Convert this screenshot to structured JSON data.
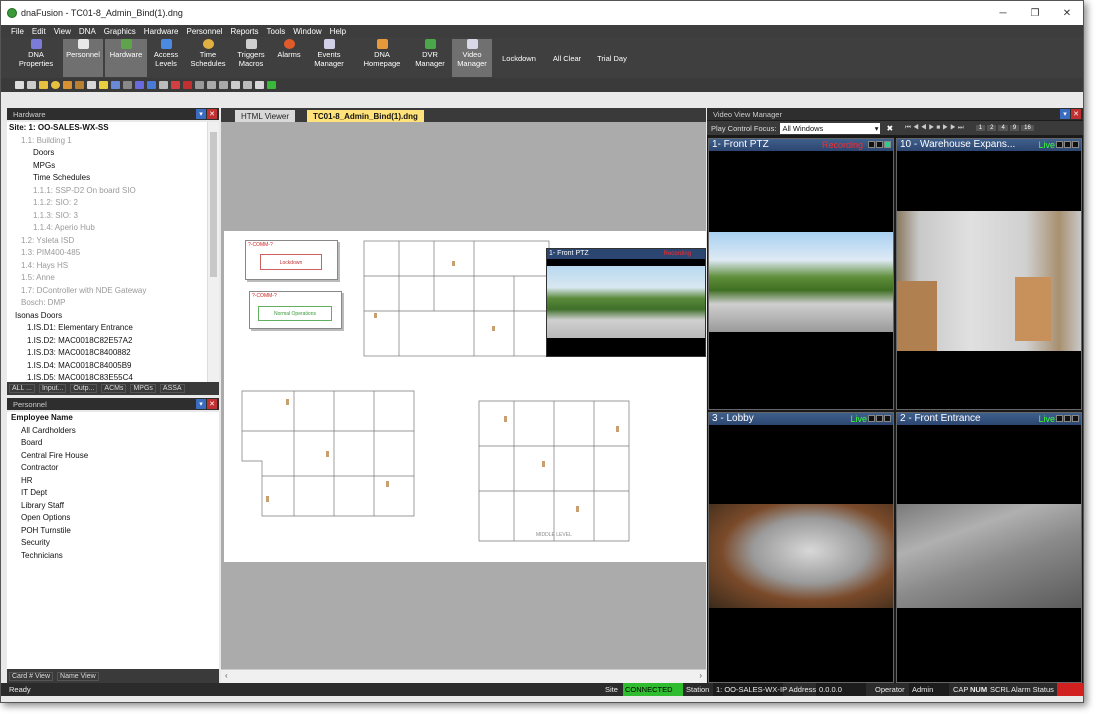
{
  "window": {
    "title": "dnaFusion - TC01-8_Admin_Bind(1).dng",
    "minimize": "─",
    "restore": "❐",
    "close": "✕"
  },
  "menu": [
    "File",
    "Edit",
    "View",
    "DNA",
    "Graphics",
    "Hardware",
    "Personnel",
    "Reports",
    "Tools",
    "Window",
    "Help"
  ],
  "ribbon": [
    {
      "l1": "DNA",
      "l2": "Properties"
    },
    {
      "l1": "Personnel",
      "l2": ""
    },
    {
      "l1": "Hardware",
      "l2": ""
    },
    {
      "l1": "Access",
      "l2": "Levels"
    },
    {
      "l1": "Time",
      "l2": "Schedules"
    },
    {
      "l1": "Triggers",
      "l2": "Macros"
    },
    {
      "l1": "Alarms",
      "l2": ""
    },
    {
      "l1": "Events",
      "l2": "Manager"
    },
    {
      "l1": "DNA",
      "l2": "Homepage"
    },
    {
      "l1": "DVR",
      "l2": "Manager"
    },
    {
      "l1": "Video",
      "l2": "Manager"
    },
    {
      "l1": "Lockdown",
      "l2": ""
    },
    {
      "l1": "All Clear",
      "l2": ""
    },
    {
      "l1": "Trial Day",
      "l2": ""
    }
  ],
  "hardware_panel": {
    "title": "Hardware",
    "items": [
      "Site: 1: OO-SALES-WX-SS",
      "1.1: Building 1",
      "Doors",
      "MPGs",
      "Time Schedules",
      "1.1.1: SSP-D2 On board SIO",
      "1.1.2: SIO: 2",
      "1.1.3: SIO: 3",
      "1.1.4: Aperio Hub",
      "1.2: Ysleta ISD",
      "1.3: PIM400-485",
      "1.4: Hays HS",
      "1.5: Anne",
      "1.7: DController with NDE Gateway",
      "Bosch: DMP",
      "Isonas Doors",
      "1.IS.D1: Elementary Entrance",
      "1.IS.D2: MAC0018C82E57A2",
      "1.IS.D3: MAC0018C8400882",
      "1.IS.D4: MAC0018C84005B9",
      "1.IS.D5: MAC0018C83E55C4"
    ],
    "tabs": [
      "ALL ...",
      "Input...",
      "Outp...",
      "ACMs",
      "MPGs",
      "ASSA"
    ]
  },
  "personnel_panel": {
    "title": "Personnel",
    "items": [
      "Employee Name",
      "All Cardholders",
      "Board",
      "Central Fire House",
      "Contractor",
      "HR",
      "IT Dept",
      "Library Staff",
      "Open Options",
      "POH Turnstile",
      "Security",
      "Technicians"
    ],
    "tabs": [
      "Card # View",
      "Name View"
    ]
  },
  "doc_tabs": {
    "tab1": "HTML Viewer",
    "tab2": "TC01-8_Admin_Bind(1).dng"
  },
  "map": {
    "comm1": "?-COMM-?",
    "lockdown": "Lockdown",
    "comm2": "?-COMM-?",
    "normal": "Normal Operations",
    "ptz_title": "1- Front PTZ",
    "ptz_status": "Recording",
    "floor_label": "MIDDLE LEVEL"
  },
  "video_manager": {
    "title": "Video View Manager",
    "play_focus_label": "Play Control Focus:",
    "play_focus_value": "All Windows",
    "layouts": [
      "1",
      "2",
      "4",
      "9",
      "16"
    ],
    "cells": [
      {
        "name": "1- Front PTZ",
        "status": "Recording",
        "status_color": "#ff2a2a"
      },
      {
        "name": "10 - Warehouse Expans...",
        "status": "Live",
        "status_color": "#3cff3c"
      },
      {
        "name": "3 - Lobby",
        "status": "Live",
        "status_color": "#3cff3c"
      },
      {
        "name": "2 - Front Entrance",
        "status": "Live",
        "status_color": "#3cff3c"
      }
    ]
  },
  "status": {
    "ready": "Ready",
    "site_label": "Site",
    "site_value": "CONNECTED",
    "station_label": "Station",
    "station_value": "1: OO-SALES-WX-",
    "ip_label": "IP Address",
    "ip_value": "0.0.0.0",
    "operator_label": "Operator",
    "operator_value": "Admin",
    "cap": "CAP",
    "num": "NUM",
    "scrl": "SCRL",
    "alarm_label": "Alarm Status"
  }
}
